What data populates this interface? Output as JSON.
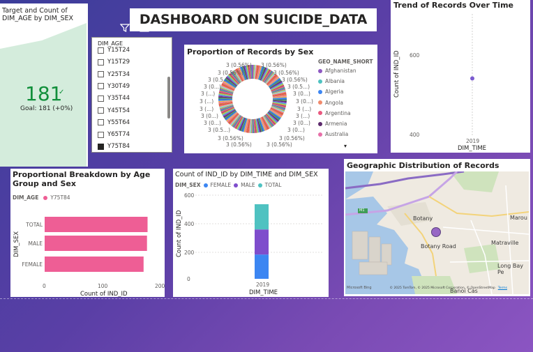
{
  "kpi": {
    "title": "Target and Count of DIM_AGE by DIM_SEX",
    "value": "181",
    "check": "✓",
    "goal": "Goal: 181 (+0%)",
    "fill_color": "#d4ecdc"
  },
  "header": {
    "title": "DASHBOARD ON SUICIDE_DATA"
  },
  "slicer": {
    "title": "DIM_AGE",
    "items": [
      {
        "label": "Y15T24",
        "checked": false
      },
      {
        "label": "Y15T29",
        "checked": false
      },
      {
        "label": "Y25T34",
        "checked": false
      },
      {
        "label": "Y30T49",
        "checked": false
      },
      {
        "label": "Y35T44",
        "checked": false
      },
      {
        "label": "Y45T54",
        "checked": false
      },
      {
        "label": "Y55T64",
        "checked": false
      },
      {
        "label": "Y65T74",
        "checked": false
      },
      {
        "label": "Y75T84",
        "checked": true
      }
    ],
    "toolbar": {
      "filter_icon": "filter-icon",
      "focus_icon": "focus-mode-icon",
      "more_icon": "more-options-icon",
      "more_label": "···"
    }
  },
  "donut": {
    "title": "Proportion of Records by Sex",
    "legend_title": "GEO_NAME_SHORT",
    "legend": [
      {
        "name": "Afghanistan",
        "color": "#8e59c2"
      },
      {
        "name": "Albania",
        "color": "#4fc2c1"
      },
      {
        "name": "Algeria",
        "color": "#3c86f2"
      },
      {
        "name": "Angola",
        "color": "#f08a6c"
      },
      {
        "name": "Argentina",
        "color": "#e9587f"
      },
      {
        "name": "Armenia",
        "color": "#5c2a6c"
      },
      {
        "name": "Australia",
        "color": "#e76fa8"
      }
    ],
    "more_indicator": "▾",
    "left_labels": [
      "3 (0.56%)",
      "3 (0.56%)",
      "3 (0.5...)",
      "3 (0...)",
      "3 (...)",
      "3 (...)",
      "3 (...)",
      "3 (0...)",
      "3 (0...)",
      "3 (0.5...)",
      "3 (0.56%)",
      "3 (0.56%)"
    ],
    "right_labels": [
      "3 (0.56%)",
      "3 (0.56%)",
      "3 (0.56%)",
      "3 (0.5...)",
      "3 (0...)",
      "3 (0...)",
      "3 (...)",
      "3 (...)",
      "3 (0...)",
      "3 (0...)",
      "3 (0.56%)",
      "3 (0.56%)"
    ]
  },
  "trend": {
    "title": "Trend of Records Over Time",
    "ylabel": "Count of IND_ID",
    "xlabel": "DIM_TIME",
    "y_ticks": [
      "600",
      "400"
    ],
    "x_tick": "2019",
    "point_color": "#7b5bd0"
  },
  "bar": {
    "title": "Proportional Breakdown by Age Group and Sex",
    "legend_field": "DIM_AGE",
    "legend_item": "Y75T84",
    "color": "#ee5e95",
    "ylabel": "DIM_SEX",
    "xlabel": "Count of IND_ID",
    "x_ticks": [
      "0",
      "100",
      "200"
    ]
  },
  "stacked": {
    "title": "Count of IND_ID by DIM_TIME and DIM_SEX",
    "legend_field": "DIM_SEX",
    "legend": [
      {
        "name": "FEMALE",
        "color": "#3c86f2"
      },
      {
        "name": "MALE",
        "color": "#7e4dcc"
      },
      {
        "name": "TOTAL",
        "color": "#4fc2c1"
      }
    ],
    "ylabel": "Count of IND_ID",
    "xlabel": "DIM_TIME",
    "y_ticks": [
      "600",
      "400",
      "200",
      "0"
    ],
    "x_tick": "2019"
  },
  "map": {
    "title": "Geographic Distribution of Records",
    "labels": {
      "botany": "Botany",
      "botany_road": "Botany Road",
      "maroubra": "Marou",
      "matraville": "Matraville",
      "long_bay": "Long Bay Pe",
      "m1": "M1",
      "bottom_partial": "Banoi Cas"
    },
    "attribution_brand": "Microsoft Bing",
    "attribution": "© 2025 TomTom, © 2025 Microsoft Corporation, © OpenStreetMap",
    "terms": "Terms",
    "marker_color": "#8e59c2"
  },
  "chart_data": [
    {
      "type": "pie",
      "title": "Proportion of Records by Sex",
      "legend_title": "GEO_NAME_SHORT",
      "slice_value": 3,
      "slice_percent": 0.56,
      "slice_count": 181,
      "visible_legend": [
        "Afghanistan",
        "Albania",
        "Algeria",
        "Angola",
        "Argentina",
        "Armenia",
        "Australia"
      ]
    },
    {
      "type": "scatter",
      "title": "Trend of Records Over Time",
      "xlabel": "DIM_TIME",
      "ylabel": "Count of IND_ID",
      "x": [
        "2019"
      ],
      "y": [
        543
      ],
      "ylim": [
        400,
        600
      ]
    },
    {
      "type": "bar",
      "title": "Proportional Breakdown by Age Group and Sex",
      "categories": [
        "TOTAL",
        "MALE",
        "FEMALE"
      ],
      "series": [
        {
          "name": "Y75T84",
          "values": [
            181,
            180,
            174
          ]
        }
      ],
      "xlabel": "Count of IND_ID",
      "ylabel": "DIM_SEX",
      "xlim": [
        0,
        200
      ]
    },
    {
      "type": "bar",
      "title": "Count of IND_ID by DIM_TIME and DIM_SEX",
      "categories": [
        "2019"
      ],
      "series": [
        {
          "name": "FEMALE",
          "values": [
            174
          ]
        },
        {
          "name": "MALE",
          "values": [
            180
          ]
        },
        {
          "name": "TOTAL",
          "values": [
            181
          ]
        }
      ],
      "xlabel": "DIM_TIME",
      "ylabel": "Count of IND_ID",
      "ylim": [
        0,
        600
      ]
    }
  ]
}
